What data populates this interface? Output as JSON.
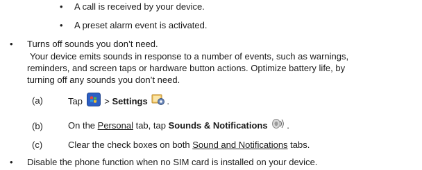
{
  "sub_bullets": [
    "A call is received by your device.",
    "A preset alarm event is activated."
  ],
  "bullet_sounds": {
    "heading": "Turns off sounds you don’t need.",
    "para_line1": "Your device emits sounds in response to a number of events, such as warnings,",
    "para_line2": "reminders, and screen taps or hardware button actions. Optimize battery life, by",
    "para_line3": "turning off any sounds you don’t need."
  },
  "steps": {
    "a": {
      "label": "(a)",
      "tap": "Tap",
      "gt": ">",
      "settings": "Settings",
      "period": ".",
      "start_icon": "windows-start-icon",
      "settings_icon": "settings-icon"
    },
    "b": {
      "label": "(b)",
      "pre": "On the",
      "personal": "Personal",
      "mid": "tab, tap",
      "sounds": "Sounds & Notifications",
      "period": ".",
      "sound_icon": "speaker-icon"
    },
    "c": {
      "label": "(c)",
      "pre": "Clear the check boxes on both",
      "tabs_link": "Sound and Notifications",
      "post": "tabs."
    }
  },
  "bullet_phone": "Disable the phone function when no SIM card is installed on your device."
}
